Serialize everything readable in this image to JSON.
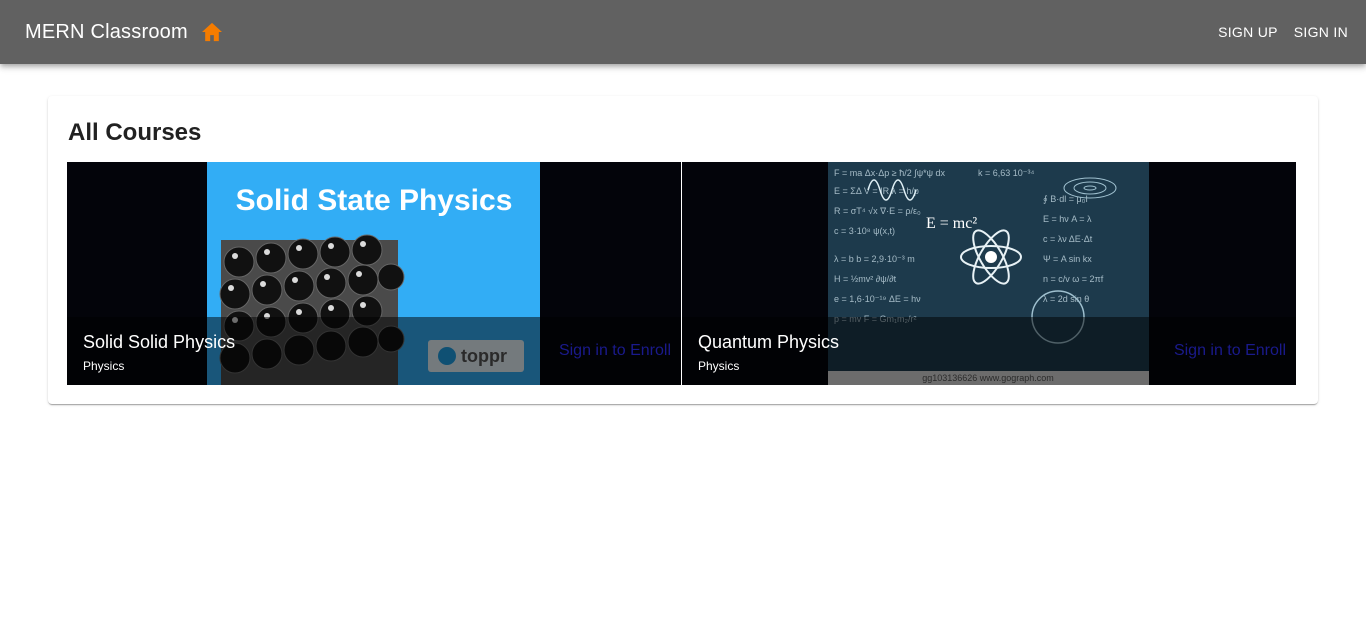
{
  "appbar": {
    "title": "MERN Classroom",
    "home_icon": "home-icon",
    "accent_color": "#f57c00",
    "links": [
      "SIGN UP",
      "SIGN IN"
    ]
  },
  "courses": {
    "title": "All Courses",
    "items": [
      {
        "name": "Solid Solid Physics",
        "category": "Physics",
        "action": "Sign in to Enroll",
        "image": {
          "headline": "Solid State Physics",
          "brand": "toppr"
        }
      },
      {
        "name": "Quantum Physics",
        "category": "Physics",
        "action": "Sign in to Enroll",
        "image": {
          "formula": "E = mc²",
          "watermark": "gg103136626 www.gograph.com"
        }
      }
    ]
  }
}
